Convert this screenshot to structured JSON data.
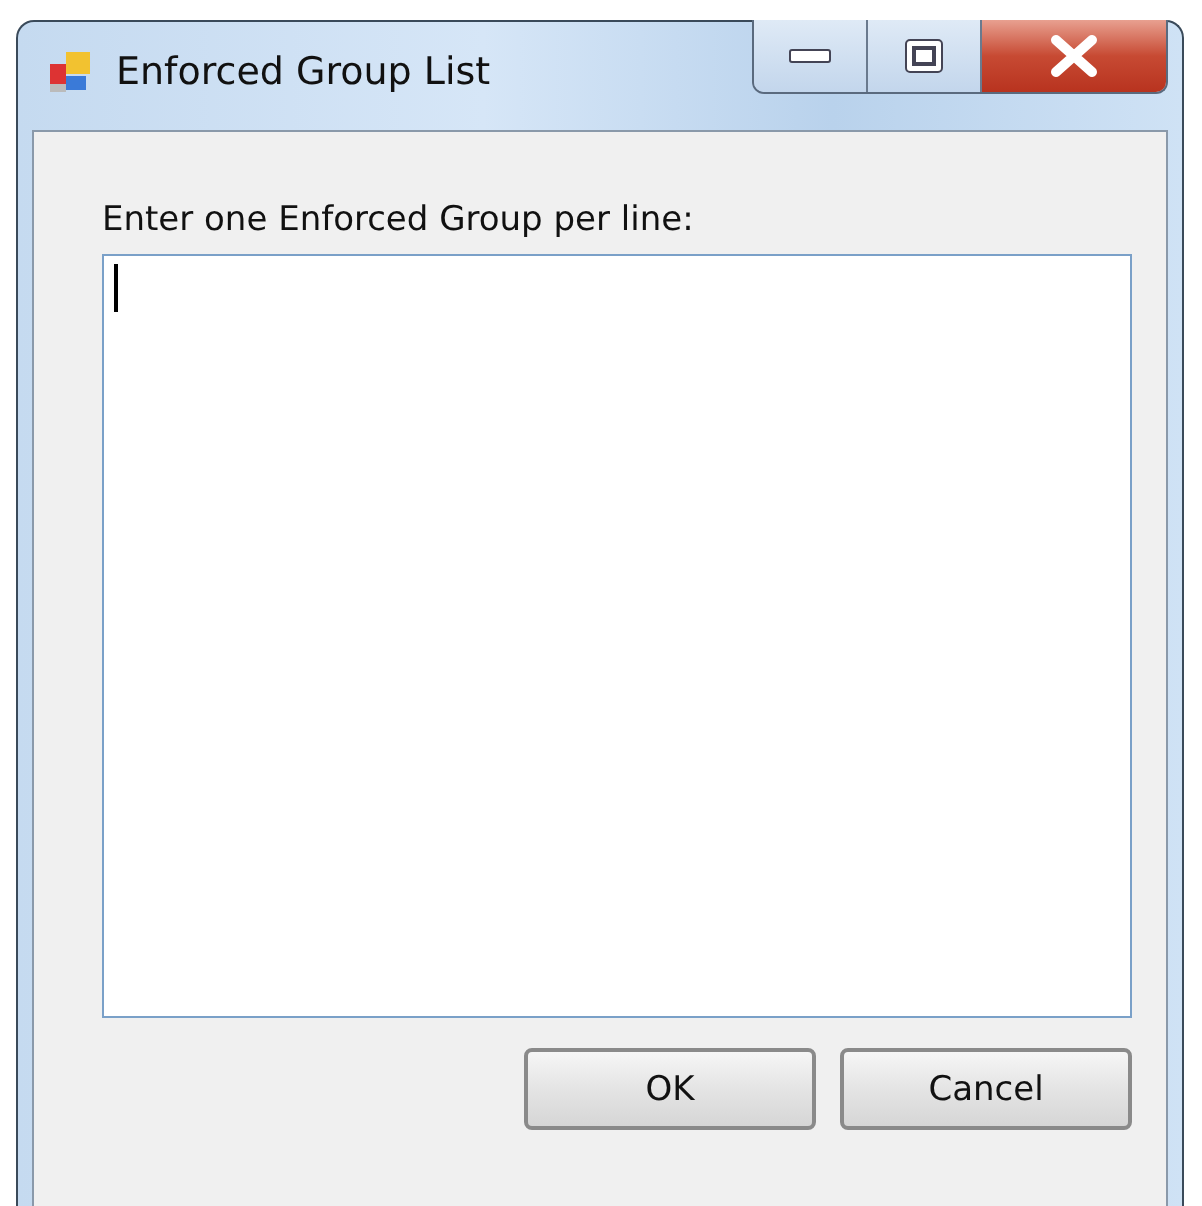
{
  "window": {
    "title": "Enforced Group List"
  },
  "prompt": "Enter one Enforced Group per line:",
  "text_area": {
    "focused": true
  },
  "buttons": [
    {
      "label": "OK"
    },
    {
      "label": "Cancel"
    }
  ]
}
